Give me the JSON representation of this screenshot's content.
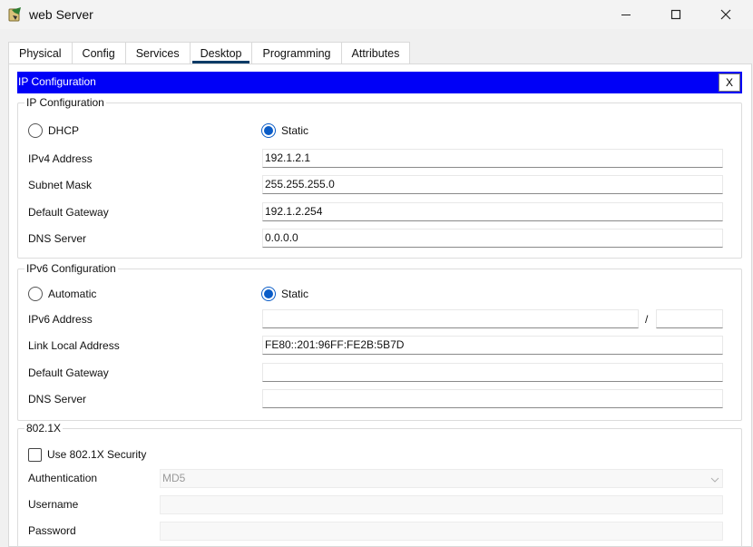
{
  "window": {
    "title": "web Server"
  },
  "tabs": [
    "Physical",
    "Config",
    "Services",
    "Desktop",
    "Programming",
    "Attributes"
  ],
  "active_tab": "Desktop",
  "ip_config_panel": {
    "header_title": "IP Configuration",
    "close_label": "X"
  },
  "ipv4": {
    "section_label": "IP Configuration",
    "dhcp_label": "DHCP",
    "static_label": "Static",
    "selected_mode": "Static",
    "ipv4_address_label": "IPv4 Address",
    "ipv4_address_value": "192.1.2.1",
    "subnet_mask_label": "Subnet Mask",
    "subnet_mask_value": "255.255.255.0",
    "gateway_label": "Default Gateway",
    "gateway_value": "192.1.2.254",
    "dns_label": "DNS Server",
    "dns_value": "0.0.0.0"
  },
  "ipv6": {
    "section_label": "IPv6 Configuration",
    "automatic_label": "Automatic",
    "static_label": "Static",
    "selected_mode": "Static",
    "ipv6_address_label": "IPv6 Address",
    "ipv6_address_value": "",
    "prefix_separator": "/",
    "prefix_value": "",
    "link_local_label": "Link Local Address",
    "link_local_value": "FE80::201:96FF:FE2B:5B7D",
    "gateway_label": "Default Gateway",
    "gateway_value": "",
    "dns_label": "DNS Server",
    "dns_value": ""
  },
  "dot1x": {
    "section_label": "802.1X",
    "use_security_label": "Use 802.1X Security",
    "use_security_checked": false,
    "authentication_label": "Authentication",
    "authentication_value": "MD5",
    "username_label": "Username",
    "username_value": "",
    "password_label": "Password",
    "password_value": ""
  },
  "colors": {
    "header_blue": "#0000f7",
    "radio_accent": "#0a5cc7",
    "tab_underline": "#0b3b66"
  }
}
